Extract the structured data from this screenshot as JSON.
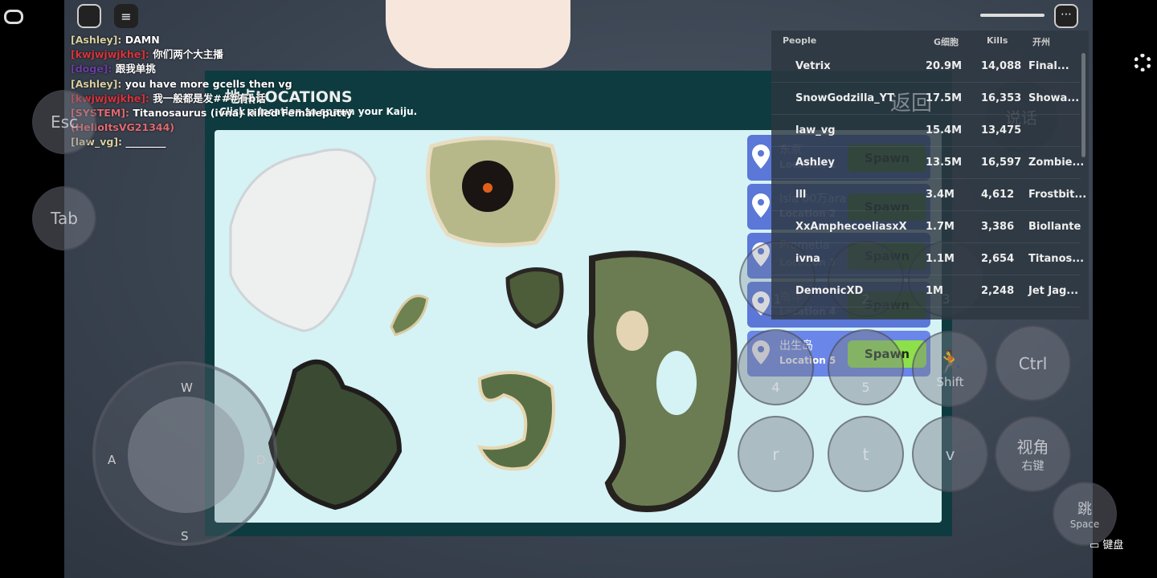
{
  "chat": [
    {
      "name": "[Ashley]:",
      "color": "#d9d0a0",
      "msg": "DAMN"
    },
    {
      "name": "[kwjwjwjkhe]:",
      "color": "#d9343c",
      "msg": "你们两个大主播"
    },
    {
      "name": "[doge]:",
      "color": "#6a3fa0",
      "msg": "跟我单挑"
    },
    {
      "name": "[Ashley]:",
      "color": "#d9d0a0",
      "msg": "you have more gcells then vg"
    },
    {
      "name": "[kwjwjwjkhe]:",
      "color": "#d9343c",
      "msg": "我一般都是发###有b话"
    },
    {
      "name": "[SYSTEM]:",
      "color": "#e06a70",
      "msg": "Titanosaurus (ivna) killed Femaleputty"
    },
    {
      "name": "(HelloItsVG21344)",
      "color": "#e06a70",
      "msg": ""
    },
    {
      "name": "[law_vg]:",
      "color": "#d9d0a0",
      "msg": "________"
    }
  ],
  "panel": {
    "title": "地点LOCATIONS",
    "subtitle": "Click a location to spawn your Kaiju."
  },
  "locations": [
    {
      "name": "东京",
      "sub": "Location 1",
      "spawn": "Spawn"
    },
    {
      "name": "Isla 00万ara",
      "sub": "Location 2",
      "spawn": "Spawn"
    },
    {
      "name": "Prometia",
      "sub": "Location 3",
      "spawn": "Spawn"
    },
    {
      "name": "南洋",
      "sub": "Location 4",
      "spawn": "Spawn"
    },
    {
      "name": "出生岛",
      "sub": "Location 5",
      "spawn": "Spawn"
    }
  ],
  "leaderboard": {
    "headers": [
      "People",
      "G细胞",
      "Kills",
      "开州"
    ],
    "rows": [
      [
        "Vetrix",
        "20.9M",
        "14,088",
        "Final..."
      ],
      [
        "SnowGodzilla_YT",
        "17.5M",
        "16,353",
        "Showa..."
      ],
      [
        "law_vg",
        "15.4M",
        "13,475",
        ""
      ],
      [
        "Ashley",
        "13.5M",
        "16,597",
        "Zombie..."
      ],
      [
        "lll",
        "3.4M",
        "4,612",
        "Frostbit..."
      ],
      [
        "XxAmphecoeliasxX",
        "1.7M",
        "3,386",
        "Biollante"
      ],
      [
        "ivna",
        "1.1M",
        "2,654",
        "Titanos..."
      ],
      [
        "DemonicXD",
        "1M",
        "2,248",
        "Jet Jag..."
      ]
    ]
  },
  "controls": {
    "esc": "Esc",
    "tab": "Tab",
    "back": "返回",
    "talk": "说话",
    "ctrl": "Ctrl",
    "shift": "Shift",
    "view": "视角",
    "view_sub": "右键",
    "r": "r",
    "t": "t",
    "v": "v",
    "k4": "4",
    "k5": "5",
    "k1": "1",
    "k2": "2",
    "k3": "3",
    "jump": "跳",
    "jump_sub": "Space",
    "keyboard": "键盘",
    "joy_w": "W",
    "joy_a": "A",
    "joy_s": "S",
    "joy_d": "D"
  }
}
